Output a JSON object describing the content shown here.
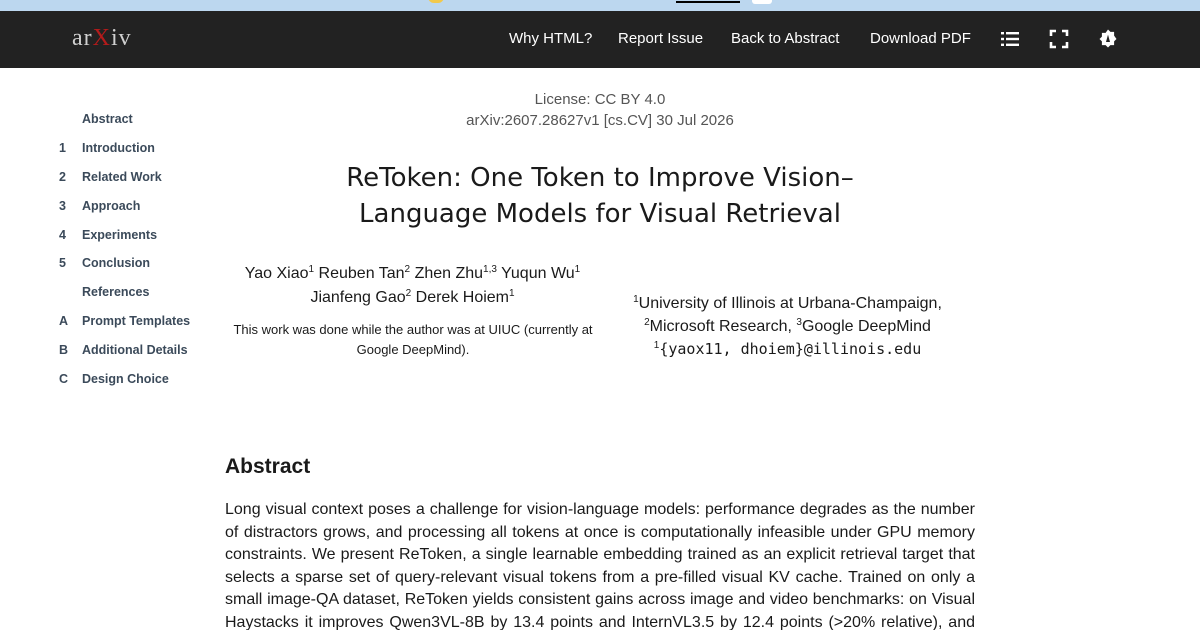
{
  "site": {
    "logo_pre": "ar",
    "logo_x": "X",
    "logo_post": "iv"
  },
  "nav": {
    "links": [
      "Why HTML?",
      "Report Issue",
      "Back to Abstract",
      "Download PDF"
    ],
    "icons": [
      "list-icon",
      "fullscreen-icon",
      "settings-icon"
    ]
  },
  "toc": [
    {
      "num": "",
      "label": "Abstract"
    },
    {
      "num": "1",
      "label": "Introduction"
    },
    {
      "num": "2",
      "label": "Related Work"
    },
    {
      "num": "3",
      "label": "Approach"
    },
    {
      "num": "4",
      "label": "Experiments"
    },
    {
      "num": "5",
      "label": "Conclusion"
    },
    {
      "num": "",
      "label": "References"
    },
    {
      "num": "A",
      "label": "Prompt Templates"
    },
    {
      "num": "B",
      "label": "Additional Details"
    },
    {
      "num": "C",
      "label": "Design Choice"
    }
  ],
  "paper": {
    "license": "License: CC BY 4.0",
    "arxiv_id": "arXiv:2607.28627v1 [cs.CV] 30 Jul 2026",
    "title_line1": "ReToken: One Token to Improve Vision–",
    "title_line2": "Language Models for Visual Retrieval",
    "authors": {
      "a1": "Yao Xiao",
      "a1_sup": "1",
      "a2": "Reuben Tan",
      "a2_sup": "2",
      "a3": "Zhen Zhu",
      "a3_sup": "1,3",
      "a4": "Yuqun Wu",
      "a4_sup": "1",
      "a5": "Jianfeng Gao",
      "a5_sup": "2",
      "a6": "Derek Hoiem",
      "a6_sup": "1"
    },
    "note": "This work was done while the author was at UIUC (currently at Google DeepMind).",
    "affiliations": {
      "s1": "1",
      "u1": "University of Illinois at Urbana-Champaign, ",
      "s2": "2",
      "u2": "Microsoft Research, ",
      "s3": "3",
      "u3": "Google DeepMind",
      "s4": "1",
      "email": "{yaox11, dhoiem}@illinois.edu"
    },
    "abstract_heading": "Abstract",
    "abstract_text": "Long visual context poses a challenge for vision-language models: performance degrades as the number of distractors grows, and processing all tokens at once is computationally infeasible under GPU memory constraints. We present ReToken, a single learnable embedding trained as an explicit retrieval target that selects a sparse set of query-relevant visual tokens from a pre-filled visual KV cache. Trained on only a small image-QA dataset, ReToken yields consistent gains across image and video benchmarks: on Visual Haystacks it improves Qwen3VL-8B by 13.4 points and InternVL3.5 by 12.4 points (>20% relative), and on LVBench it transfers zero-shot to long video for an"
  }
}
